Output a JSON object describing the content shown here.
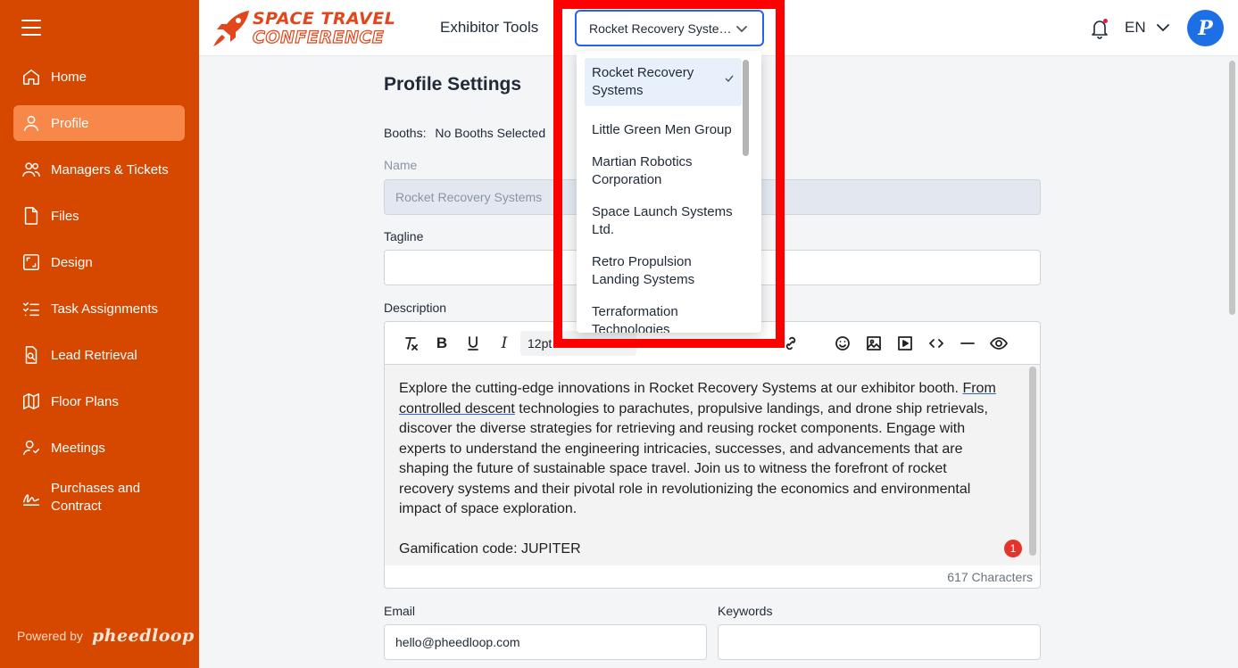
{
  "app": {
    "logo_line1": "SPACE TRAVEL",
    "logo_line2": "CONFERENCE",
    "section_label": "Exhibitor Tools",
    "powered_by": "Powered by",
    "powered_brand": "pheedloop",
    "language": "EN",
    "avatar_letter": "P"
  },
  "exhibitor_selector": {
    "selected": "Rocket Recovery Systems",
    "options": [
      "Rocket Recovery Systems",
      "Little Green Men Group",
      "Martian Robotics Corporation",
      "Space Launch Systems Ltd.",
      "Retro Propulsion Landing Systems",
      "Terraformation Technologies"
    ]
  },
  "sidebar": {
    "items": [
      {
        "label": "Home",
        "icon": "home-icon"
      },
      {
        "label": "Profile",
        "icon": "user-icon"
      },
      {
        "label": "Managers & Tickets",
        "icon": "users-icon"
      },
      {
        "label": "Files",
        "icon": "file-icon"
      },
      {
        "label": "Design",
        "icon": "design-icon"
      },
      {
        "label": "Task Assignments",
        "icon": "checklist-icon"
      },
      {
        "label": "Lead Retrieval",
        "icon": "lead-icon"
      },
      {
        "label": "Floor Plans",
        "icon": "map-icon"
      },
      {
        "label": "Meetings",
        "icon": "meetings-icon"
      },
      {
        "label": "Purchases and Contract",
        "icon": "signature-icon"
      }
    ]
  },
  "form": {
    "title": "Profile Settings",
    "booths_label": "Booths:",
    "booths_value": "No Booths Selected",
    "name_label": "Name",
    "name_value": "Rocket Recovery Systems",
    "tagline_label": "Tagline",
    "tagline_value": "",
    "description_label": "Description",
    "font_size": "12pt",
    "description_intro": "Explore the cutting-edge innovations in Rocket Recovery Systems at our exhibitor booth. ",
    "description_link": "From controlled descent",
    "description_rest": " technologies to parachutes, propulsive landings, and drone ship retrievals, discover the diverse strategies for retrieving and reusing rocket components. Engage with experts to understand the engineering intricacies, successes, and advancements that are shaping the future of sustainable space travel. Join us to witness the forefront of rocket recovery systems and their pivotal role in revolutionizing the economics and environmental impact of space exploration.",
    "gamification": "Gamification code: JUPITER",
    "issue_count": "1",
    "char_count": "617 Characters",
    "email_label": "Email",
    "email_value": "hello@pheedloop.com",
    "keywords_label": "Keywords",
    "keywords_value": ""
  },
  "colors": {
    "sidebar_bg": "#d64700",
    "sidebar_active": "#f7884a",
    "accent_blue": "#2563eb",
    "highlight": "#ff0000"
  }
}
